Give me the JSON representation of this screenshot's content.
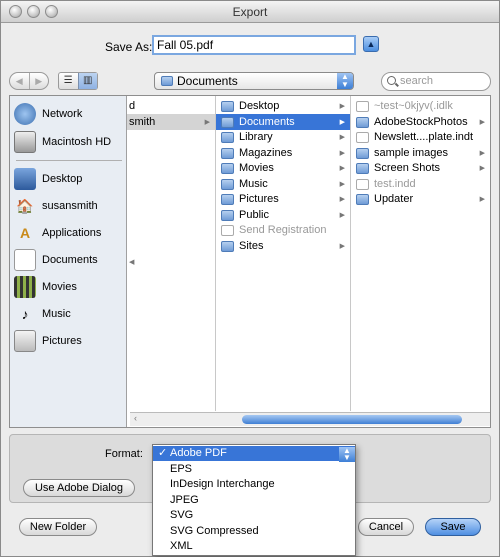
{
  "window": {
    "title": "Export"
  },
  "save_as": {
    "label": "Save As:",
    "value": "Fall 05.pdf"
  },
  "location": {
    "value": "Documents"
  },
  "search": {
    "placeholder": "search"
  },
  "sidebar": {
    "devices": [
      {
        "label": "Network",
        "icon": "globe-icon"
      },
      {
        "label": "Macintosh HD",
        "icon": "hard-drive-icon"
      }
    ],
    "places": [
      {
        "label": "Desktop",
        "icon": "desktop-icon"
      },
      {
        "label": "susansmith",
        "icon": "home-icon"
      },
      {
        "label": "Applications",
        "icon": "applications-icon"
      },
      {
        "label": "Documents",
        "icon": "documents-icon"
      },
      {
        "label": "Movies",
        "icon": "movies-icon"
      },
      {
        "label": "Music",
        "icon": "music-icon"
      },
      {
        "label": "Pictures",
        "icon": "pictures-icon"
      }
    ]
  },
  "columns": {
    "col1": [
      {
        "label": "d"
      },
      {
        "label": "smith"
      }
    ],
    "col2": [
      {
        "label": "Desktop"
      },
      {
        "label": "Documents"
      },
      {
        "label": "Library"
      },
      {
        "label": "Magazines"
      },
      {
        "label": "Movies"
      },
      {
        "label": "Music"
      },
      {
        "label": "Pictures"
      },
      {
        "label": "Public"
      },
      {
        "label": "Send Registration"
      },
      {
        "label": "Sites"
      }
    ],
    "col3": [
      {
        "label": "~test~0kjyv(.idlk"
      },
      {
        "label": "AdobeStockPhotos"
      },
      {
        "label": "Newslett....plate.indt"
      },
      {
        "label": "sample images"
      },
      {
        "label": "Screen Shots"
      },
      {
        "label": "test.indd"
      },
      {
        "label": "Updater"
      }
    ]
  },
  "format": {
    "label": "Format:",
    "selected": "Adobe PDF",
    "check": "✓",
    "options": [
      "EPS",
      "InDesign Interchange",
      "JPEG",
      "SVG",
      "SVG Compressed",
      "XML"
    ]
  },
  "buttons": {
    "use_adobe_dialog": "Use Adobe Dialog",
    "new_folder": "New Folder",
    "cancel": "Cancel",
    "save": "Save"
  }
}
